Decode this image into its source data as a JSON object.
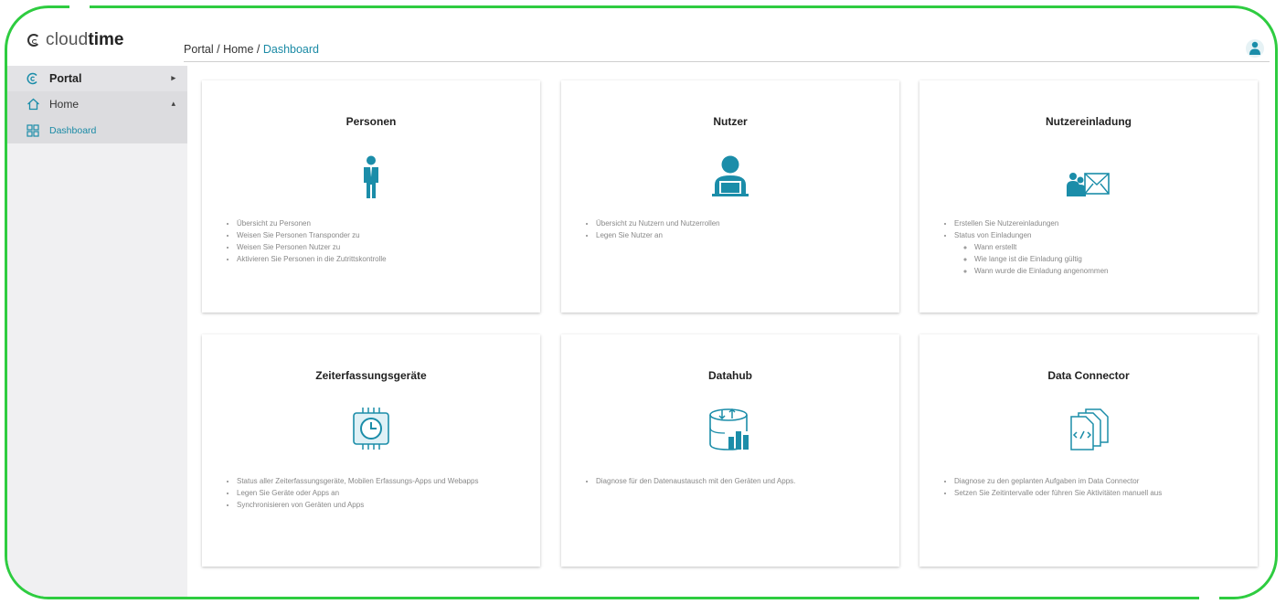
{
  "app": {
    "logo_light": "cloud",
    "logo_bold": "time"
  },
  "breadcrumb": {
    "part1": "Portal",
    "sep": " / ",
    "part2": "Home",
    "part3": "Dashboard"
  },
  "sidebar": {
    "items": [
      {
        "label": "Portal"
      },
      {
        "label": "Home"
      },
      {
        "label": "Dashboard"
      }
    ]
  },
  "cards": [
    {
      "title": "Personen",
      "bullets": [
        "Übersicht zu Personen",
        "Weisen Sie Personen Transponder zu",
        "Weisen Sie Personen Nutzer zu",
        "Aktivieren Sie Personen in die Zutrittskontrolle"
      ]
    },
    {
      "title": "Nutzer",
      "bullets": [
        "Übersicht zu Nutzern und Nutzerrollen",
        "Legen Sie Nutzer an"
      ]
    },
    {
      "title": "Nutzereinladung",
      "bullets": [
        "Erstellen Sie Nutzereinladungen",
        "Status von Einladungen"
      ],
      "subbullets": [
        "Wann erstellt",
        "Wie lange ist die Einladung gültig",
        "Wann wurde die Einladung angenommen"
      ]
    },
    {
      "title": "Zeiterfassungsgeräte",
      "bullets": [
        "Status aller Zeiterfassungsgeräte, Mobilen Erfassungs-Apps und Webapps",
        "Legen Sie Geräte oder Apps an",
        "Synchronisieren von Geräten und Apps"
      ]
    },
    {
      "title": "Datahub",
      "bullets": [
        "Diagnose für den Datenaustausch mit den Geräten und Apps."
      ]
    },
    {
      "title": "Data Connector",
      "bullets": [
        "Diagnose zu den geplanten Aufgaben im Data Connector",
        "Setzen Sie Zeitintervalle oder führen Sie Aktivitäten manuell aus"
      ]
    }
  ],
  "colors": {
    "accent": "#1a8aa5",
    "frame": "#2ecc40",
    "icon": "#1b8da9"
  }
}
